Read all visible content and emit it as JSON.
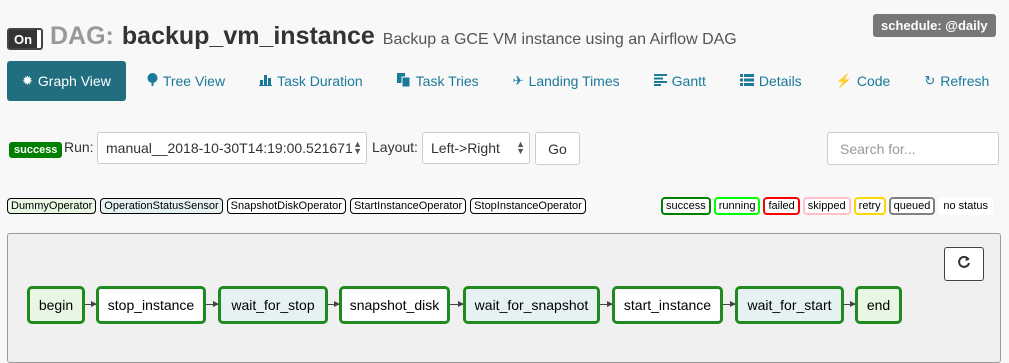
{
  "header": {
    "toggle_label": "On",
    "dag_prefix": "DAG:",
    "dag_id": "backup_vm_instance",
    "description": "Backup a GCE VM instance using an Airflow DAG",
    "schedule": "schedule: @daily"
  },
  "nav": [
    {
      "label": "Graph View",
      "icon": "asterisk-icon",
      "active": true
    },
    {
      "label": "Tree View",
      "icon": "tree-icon"
    },
    {
      "label": "Task Duration",
      "icon": "bar-chart-icon"
    },
    {
      "label": "Task Tries",
      "icon": "duplicate-icon"
    },
    {
      "label": "Landing Times",
      "icon": "plane-icon"
    },
    {
      "label": "Gantt",
      "icon": "align-left-icon"
    },
    {
      "label": "Details",
      "icon": "list-icon"
    },
    {
      "label": "Code",
      "icon": "flash-icon"
    },
    {
      "label": "Refresh",
      "icon": "refresh-icon"
    }
  ],
  "run_bar": {
    "state_badge": "success",
    "run_label": "Run:",
    "run_value": "manual__2018-10-30T14:19:00.521671",
    "layout_label": "Layout:",
    "layout_value": "Left->Right",
    "go_label": "Go",
    "search_placeholder": "Search for..."
  },
  "operator_legend": [
    {
      "label": "DummyOperator",
      "color": "#e8f7e4"
    },
    {
      "label": "OperationStatusSensor",
      "color": "#e6f1f2"
    },
    {
      "label": "SnapshotDiskOperator",
      "color": "#ffffff"
    },
    {
      "label": "StartInstanceOperator",
      "color": "#ffffff"
    },
    {
      "label": "StopInstanceOperator",
      "color": "#ffffff"
    }
  ],
  "state_legend": [
    {
      "label": "success",
      "color": "#008000"
    },
    {
      "label": "running",
      "color": "#00ff00"
    },
    {
      "label": "failed",
      "color": "#ff0000"
    },
    {
      "label": "skipped",
      "color": "#ffc0cb"
    },
    {
      "label": "retry",
      "color": "#ffd700"
    },
    {
      "label": "queued",
      "color": "#808080"
    },
    {
      "label": "no status",
      "color": "none"
    }
  ],
  "graph": {
    "nodes": [
      {
        "label": "begin",
        "fill": "#e8f7e4"
      },
      {
        "label": "stop_instance",
        "fill": "#ffffff"
      },
      {
        "label": "wait_for_stop",
        "fill": "#e6f1f2"
      },
      {
        "label": "snapshot_disk",
        "fill": "#ffffff"
      },
      {
        "label": "wait_for_snapshot",
        "fill": "#e6f1f2"
      },
      {
        "label": "start_instance",
        "fill": "#ffffff"
      },
      {
        "label": "wait_for_start",
        "fill": "#e6f1f2"
      },
      {
        "label": "end",
        "fill": "#e8f7e4"
      }
    ],
    "node_border_color": "#1f8a1f"
  }
}
